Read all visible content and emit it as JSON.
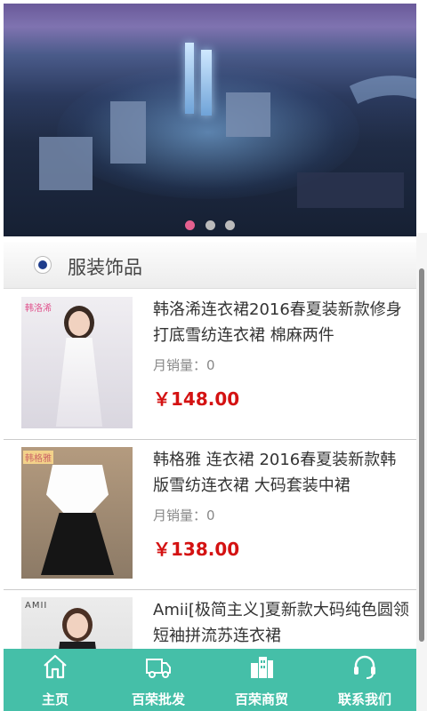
{
  "banner": {
    "slide_count": 3,
    "active_slide": 1
  },
  "section": {
    "title": "服装饰品"
  },
  "products": [
    {
      "title": "韩洛浠连衣裙2016春夏装新款修身打底雪纺连衣裙 棉麻两件",
      "sales": "月销量：0",
      "price": "￥148.00",
      "brand": "韩洛浠"
    },
    {
      "title": "韩格雅 连衣裙 2016春夏装新款韩版雪纺连衣裙 大码套装中裙",
      "sales": "月销量：0",
      "price": "￥138.00",
      "brand": "韩格雅"
    },
    {
      "title": "Amii[极简主义]夏新款大码纯色圆领短袖拼流苏连衣裙",
      "sales": "",
      "price": "",
      "brand": "AMII"
    }
  ],
  "tabbar": {
    "items": [
      {
        "label": "主页",
        "icon": "home-icon"
      },
      {
        "label": "百荣批发",
        "icon": "truck-icon"
      },
      {
        "label": "百荣商贸",
        "icon": "buildings-icon"
      },
      {
        "label": "联系我们",
        "icon": "headset-icon"
      }
    ],
    "color": "#45bfa8"
  },
  "colors": {
    "price": "#d41212",
    "dot_active": "#e5608f",
    "radio": "#1f3d8c"
  }
}
